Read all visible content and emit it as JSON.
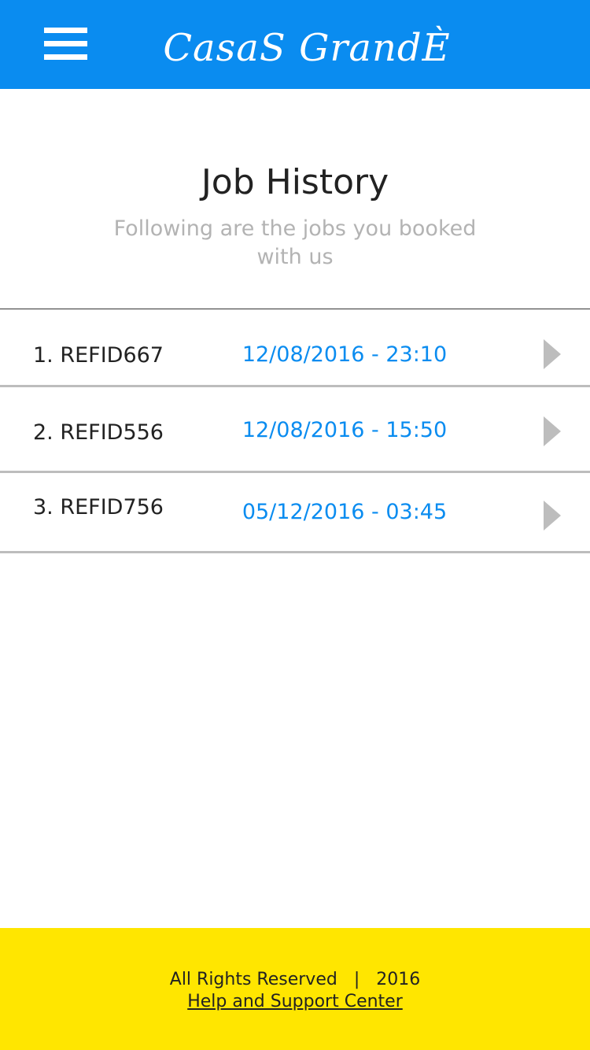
{
  "header": {
    "app_title": "CasaS GrandÈ",
    "menu_icon": "hamburger-menu-icon",
    "background_color": "#0a8cf0"
  },
  "page": {
    "title": "Job History",
    "subtitle": "Following are the jobs you booked with us"
  },
  "jobs": [
    {
      "ref": "1. REFID667",
      "datetime": "12/08/2016 - 23:10",
      "icon": "chevron-right-icon"
    },
    {
      "ref": "2. REFID556",
      "datetime": "12/08/2016 - 15:50",
      "icon": "chevron-right-icon"
    },
    {
      "ref": "3. REFID756",
      "datetime": "05/12/2016 - 03:45",
      "icon": "chevron-right-icon"
    }
  ],
  "footer": {
    "rights": "All Rights Reserved",
    "separator": "|",
    "year": "2016",
    "help_link": "Help and Support Center",
    "background_color": "#ffe600"
  },
  "colors": {
    "accent": "#0a8cf0",
    "footer": "#ffe600",
    "divider": "#bdbdbd",
    "muted_text": "#b3b3b3"
  }
}
